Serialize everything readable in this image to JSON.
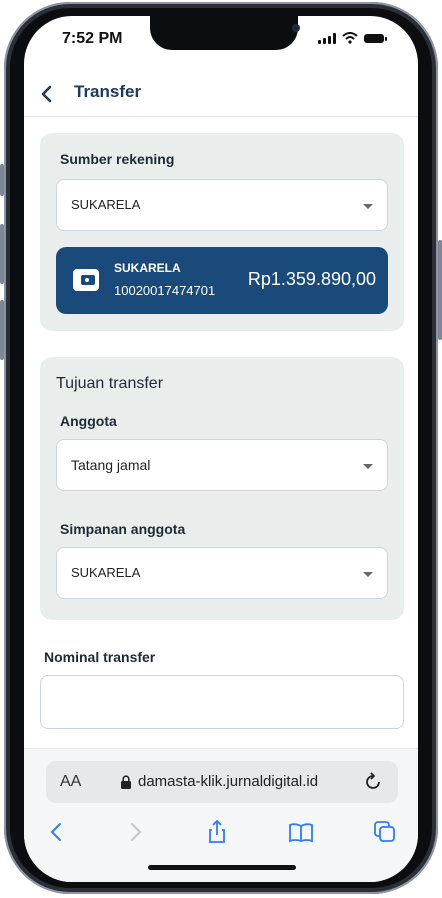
{
  "status_bar": {
    "time": "7:52 PM"
  },
  "header": {
    "title": "Transfer"
  },
  "source": {
    "label": "Sumber rekening",
    "selected": "SUKARELA",
    "account_card": {
      "name": "SUKARELA",
      "number": "10020017474701",
      "balance": "Rp1.359.890,00"
    }
  },
  "destination": {
    "heading": "Tujuan transfer",
    "member_label": "Anggota",
    "member_selected": "Tatang jamal",
    "savings_label": "Simpanan anggota",
    "savings_selected": "SUKARELA"
  },
  "nominal": {
    "label": "Nominal transfer",
    "value": ""
  },
  "browser": {
    "aa_label": "AA",
    "url": "damasta-klik.jurnaldigital.id",
    "icons": [
      "back-icon",
      "forward-icon",
      "share-icon",
      "bookmarks-icon",
      "tabs-icon",
      "reload-icon",
      "lock-icon"
    ]
  },
  "colors": {
    "primary": "#1a4a7a",
    "card_bg": "#e9eeec",
    "title": "#1e3a5c"
  }
}
